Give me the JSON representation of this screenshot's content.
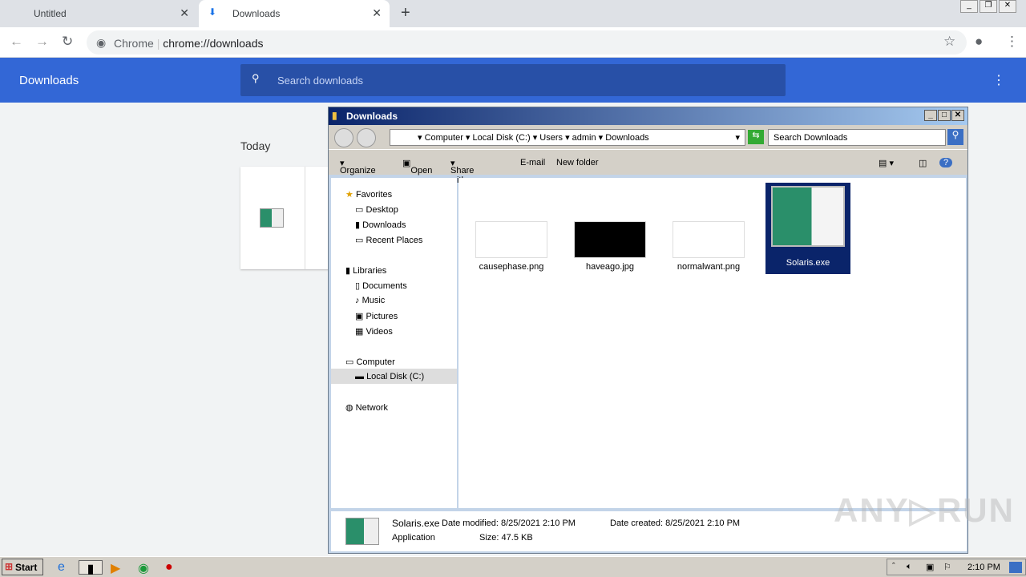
{
  "browser": {
    "tabs": [
      {
        "label": "Untitled"
      },
      {
        "label": "Downloads",
        "icon": "download-icon"
      }
    ],
    "url_chip": "Chrome",
    "url": "chrome://downloads"
  },
  "downloads_page": {
    "title": "Downloads",
    "search_placeholder": "Search downloads",
    "section": "Today"
  },
  "explorer": {
    "title": "Downloads",
    "breadcrumb": [
      "Computer",
      "Local Disk (C:)",
      "Users",
      "admin",
      "Downloads"
    ],
    "search_placeholder": "Search Downloads",
    "toolbar": {
      "organize": "Organize",
      "open": "Open",
      "share": "Share with",
      "email": "E-mail",
      "new_folder": "New folder"
    },
    "nav": {
      "favorites": "Favorites",
      "desktop": "Desktop",
      "downloads": "Downloads",
      "recent": "Recent Places",
      "libraries": "Libraries",
      "documents": "Documents",
      "music": "Music",
      "pictures": "Pictures",
      "videos": "Videos",
      "computer": "Computer",
      "local_disk": "Local Disk (C:)",
      "network": "Network"
    },
    "files": [
      {
        "name": "causephase.png"
      },
      {
        "name": "haveago.jpg"
      },
      {
        "name": "normalwant.png"
      },
      {
        "name": "Solaris.exe",
        "selected": true
      }
    ],
    "details": {
      "name": "Solaris.exe",
      "type": "Application",
      "modified_label": "Date modified:",
      "modified": "8/25/2021 2:10 PM",
      "created_label": "Date created:",
      "created": "8/25/2021 2:10 PM",
      "size_label": "Size:",
      "size": "47.5 KB"
    }
  },
  "taskbar": {
    "start": "Start",
    "clock": "2:10 PM"
  },
  "watermark": "ANY RUN"
}
